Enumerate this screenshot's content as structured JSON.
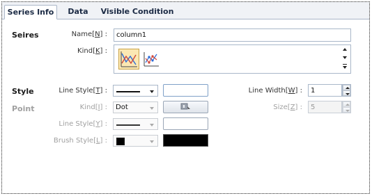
{
  "tabs": [
    {
      "label": "Series Info",
      "active": true
    },
    {
      "label": "Data",
      "active": false
    },
    {
      "label": "Visible Condition",
      "active": false
    }
  ],
  "series": {
    "section": "Seires",
    "name_label": "Name",
    "name_key": "N",
    "name_value": "column1",
    "kind_label": "Kind",
    "kind_key": "K",
    "kind_icons": [
      "line-chart-icon",
      "point-line-chart-icon"
    ]
  },
  "style": {
    "section": "Style",
    "line_style_label": "Line Style",
    "line_style_key": "T",
    "line_width_label": "Line Width",
    "line_width_key": "W",
    "line_width_value": "1"
  },
  "point": {
    "section": "Point",
    "kind_label": "Kind",
    "kind_key": "I",
    "kind_value": "Dot",
    "size_label": "Size",
    "size_key": "Z",
    "size_value": "5",
    "line_style_label": "Line Style",
    "line_style_key": "Y",
    "brush_style_label": "Brush Style",
    "brush_style_key": "L"
  },
  "colors": {
    "tab_bar": "#f0f2f6",
    "border": "#a9b7c9",
    "brush": "#000000",
    "disabled_text": "#a0a0a0"
  }
}
